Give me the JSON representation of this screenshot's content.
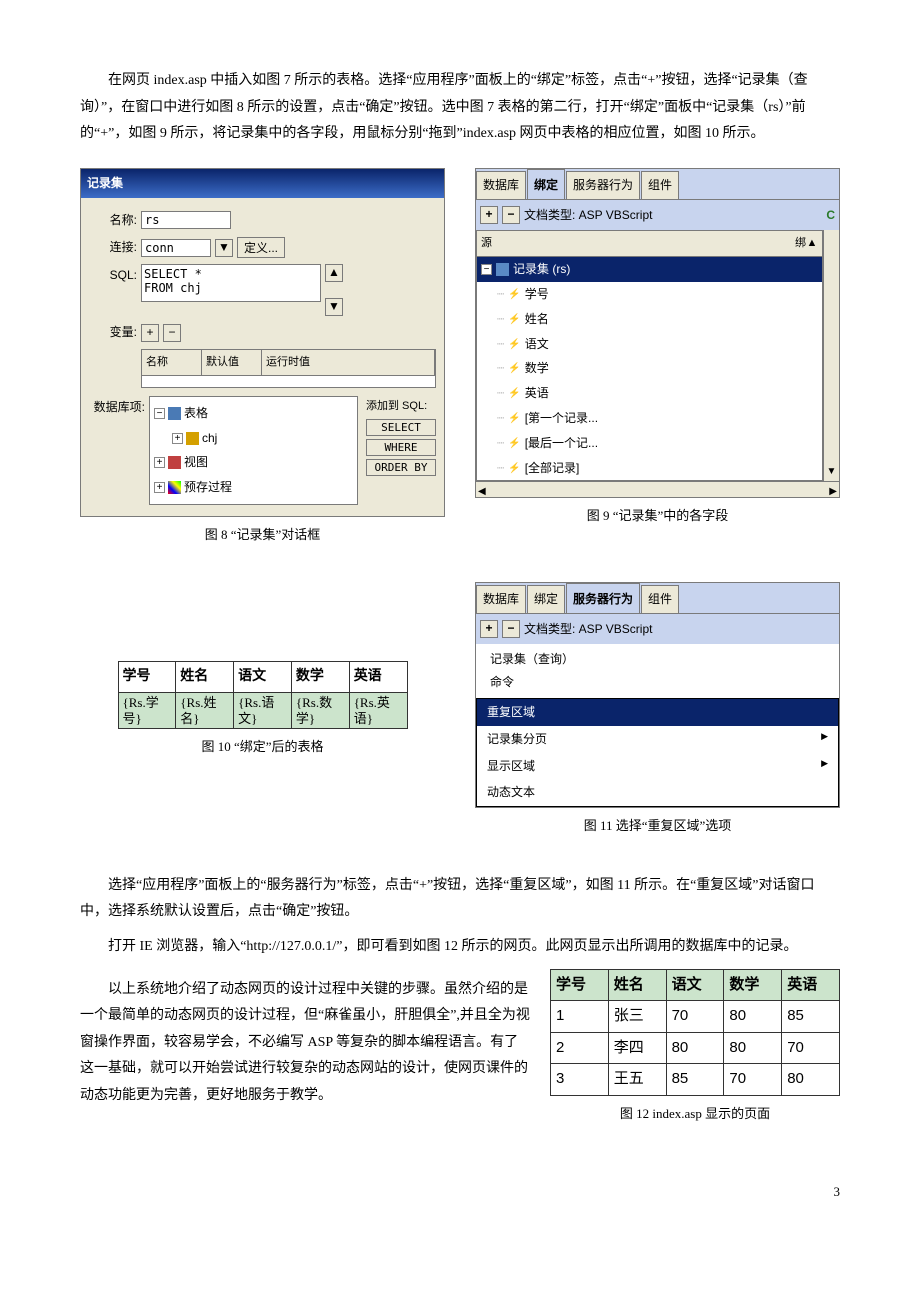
{
  "body": {
    "p1": "在网页 index.asp 中插入如图 7 所示的表格。选择“应用程序”面板上的“绑定”标签，点击“+”按钮，选择“记录集（查询）”，在窗口中进行如图 8 所示的设置，点击“确定”按钮。选中图 7 表格的第二行，打开“绑定”面板中“记录集（rs）”前的“+”，如图 9 所示，将记录集中的各字段，用鼠标分别“拖到”index.asp 网页中表格的相应位置，如图 10 所示。",
    "p2": "选择“应用程序”面板上的“服务器行为”标签，点击“+”按钮，选择“重复区域”，如图 11 所示。在“重复区域”对话窗口中，选择系统默认设置后，点击“确定”按钮。",
    "p3": "打开 IE 浏览器，输入“http://127.0.0.1/”，即可看到如图 12 所示的网页。此网页显示出所调用的数据库中的记录。",
    "p4": "以上系统地介绍了动态网页的设计过程中关键的步骤。虽然介绍的是一个最简单的动态网页的设计过程，但“麻雀虽小，肝胆俱全”,并且全为视窗操作界面，较容易学会，不必编写 ASP 等复杂的脚本编程语言。有了这一基础，就可以开始尝试进行较复杂的动态网站的设计，使网页课件的动态功能更为完善，更好地服务于教学。"
  },
  "fig8": {
    "title": "记录集",
    "name_label": "名称:",
    "name_value": "rs",
    "conn_label": "连接:",
    "conn_value": "conn",
    "define_btn": "定义...",
    "sql_label": "SQL:",
    "sql_value": "SELECT *\nFROM chj",
    "var_label": "变量:",
    "grid_cols": [
      "名称",
      "默认值",
      "运行时值"
    ],
    "db_label": "数据库项:",
    "tree": {
      "tables": "表格",
      "chj": "chj",
      "views": "视图",
      "procs": "预存过程"
    },
    "add_sql": "添加到 SQL:",
    "sql_btns": [
      "SELECT",
      "WHERE",
      "ORDER BY"
    ],
    "caption": "图 8  “记录集”对话框"
  },
  "fig9": {
    "tabs": [
      "数据库",
      "绑定",
      "服务器行为",
      "组件"
    ],
    "doctype": "文档类型: ASP VBScript",
    "src_col": "源",
    "rs_label": "记录集 (rs)",
    "fields": [
      "学号",
      "姓名",
      "语文",
      "数学",
      "英语",
      "[第一个记录...",
      "[最后一个记...",
      "[全部记录]"
    ],
    "caption": "图 9  “记录集”中的各字段"
  },
  "fig10": {
    "headers": [
      "学号",
      "姓名",
      "语文",
      "数学",
      "英语"
    ],
    "cells": [
      "{Rs.学号}",
      "{Rs.姓名}",
      "{Rs.语文}",
      "{Rs.数学}",
      "{Rs.英语}"
    ],
    "caption": "图 10  “绑定”后的表格"
  },
  "fig11": {
    "tabs": [
      "数据库",
      "绑定",
      "服务器行为",
      "组件"
    ],
    "doctype": "文档类型: ASP VBScript",
    "items_top": [
      "记录集（查询）",
      "命令"
    ],
    "items_menu": [
      "重复区域",
      "记录集分页",
      "显示区域",
      "动态文本"
    ],
    "caption": "图 11  选择“重复区域”选项"
  },
  "fig12": {
    "caption": "图 12   index.asp 显示的页面"
  },
  "chart_data": {
    "type": "table",
    "title": "index.asp 显示的页面",
    "columns": [
      "学号",
      "姓名",
      "语文",
      "数学",
      "英语"
    ],
    "rows": [
      [
        1,
        "张三",
        70,
        80,
        85
      ],
      [
        2,
        "李四",
        80,
        80,
        70
      ],
      [
        3,
        "王五",
        85,
        70,
        80
      ]
    ]
  },
  "page_num": "3"
}
